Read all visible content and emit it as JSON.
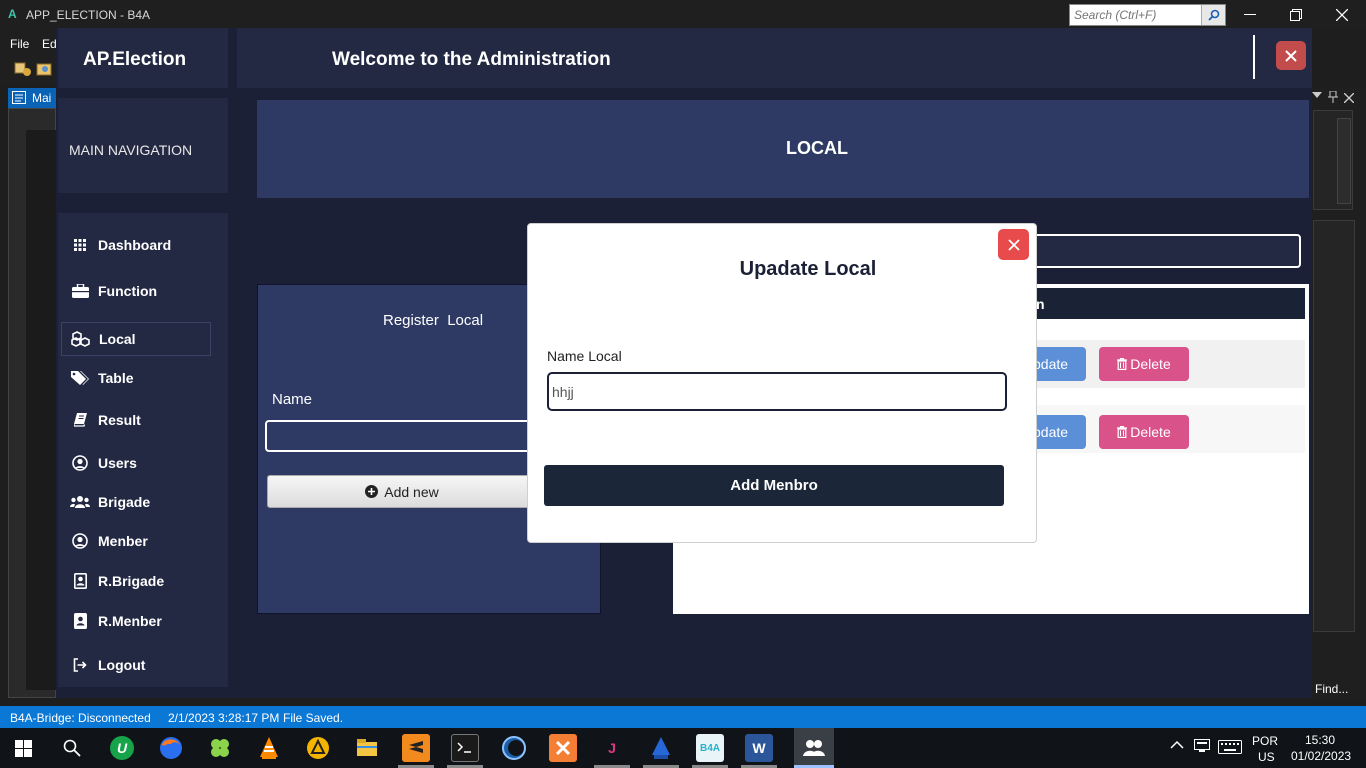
{
  "ide": {
    "title": "APP_ELECTION - B4A",
    "logo_letter": "A",
    "search_placeholder": "Search (Ctrl+F)",
    "menus": [
      "File",
      "Ed"
    ],
    "tab_label": "Mai",
    "find_label": "Find...",
    "status": {
      "bridge": "B4A-Bridge: Disconnected",
      "timestamp": "2/1/2023 3:28:17 PM",
      "message": "File Saved."
    }
  },
  "app": {
    "brand": "AP.Election",
    "header_title": "Welcome to the Administration",
    "nav_title": "MAIN NAVIGATION",
    "nav_items": [
      {
        "label": "Dashboard",
        "icon": "grid-icon"
      },
      {
        "label": "Function",
        "icon": "briefcase-icon"
      },
      {
        "label": "Local",
        "icon": "cubes-icon",
        "active": true
      },
      {
        "label": "Table",
        "icon": "tags-icon"
      },
      {
        "label": "Result",
        "icon": "book-icon"
      },
      {
        "label": "Users",
        "icon": "user-circle-icon"
      },
      {
        "label": "Brigade",
        "icon": "users-icon"
      },
      {
        "label": "Menber",
        "icon": "user-circle-icon"
      },
      {
        "label": "R.Brigade",
        "icon": "user-square-icon"
      },
      {
        "label": "R.Menber",
        "icon": "user-square-icon"
      },
      {
        "label": "Logout",
        "icon": "sign-out-icon"
      }
    ],
    "page_title": "LOCAL",
    "register": {
      "title": "Register  Local",
      "name_label": "Name",
      "name_value": "",
      "add_button": "Add new"
    },
    "list": {
      "header_text": "n",
      "rows": [
        {
          "update_label": "pdate",
          "delete_label": "Delete"
        },
        {
          "update_label": "pdate",
          "delete_label": "Delete"
        }
      ]
    },
    "modal": {
      "title": "Upadate Local",
      "field_label": "Name Local",
      "field_value": "hhjj",
      "submit_label": "Add Menbro"
    }
  },
  "taskbar": {
    "language": "POR",
    "layout": "US",
    "time": "15:30",
    "date": "01/02/2023",
    "apps": [
      "start",
      "search",
      "upwork",
      "firefox",
      "clover",
      "vlc",
      "artix",
      "file-explorer",
      "sublime",
      "terminal",
      "eclipse",
      "xampp",
      "jetbrains",
      "sourcetree",
      "b4a",
      "word",
      "app-election"
    ]
  }
}
